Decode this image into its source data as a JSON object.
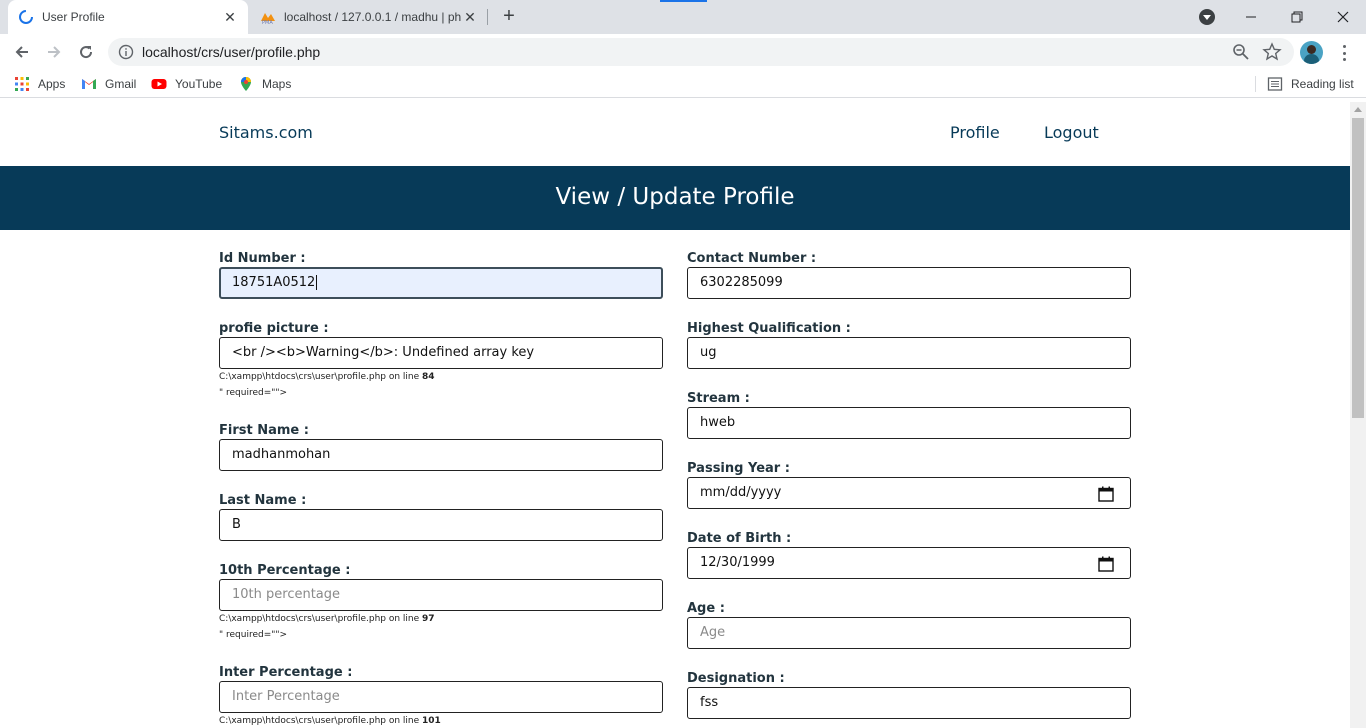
{
  "browser": {
    "tabs": [
      {
        "title": "User Profile"
      },
      {
        "title": "localhost / 127.0.0.1 / madhu | ph"
      }
    ],
    "url": "localhost/crs/user/profile.php",
    "bookmarks": [
      {
        "label": "Apps",
        "icon": "apps-grid-icon"
      },
      {
        "label": "Gmail",
        "icon": "gmail-icon"
      },
      {
        "label": "YouTube",
        "icon": "youtube-icon"
      },
      {
        "label": "Maps",
        "icon": "maps-icon"
      }
    ],
    "reading_list": "Reading list"
  },
  "site": {
    "brand": "Sitams.com",
    "nav": [
      "Profile",
      "Logout"
    ],
    "banner": "View / Update Profile"
  },
  "form": {
    "id_number": {
      "label": "Id Number :",
      "value": "18751A0512"
    },
    "profile_picture": {
      "label": "profie picture :",
      "value": "<br /><b>Warning</b>:  Undefined array key",
      "warning_path": "C:\\xampp\\htdocs\\crs\\user\\profile.php on line ",
      "warning_line": "84",
      "warning_tail": "\" required=\"\">"
    },
    "first_name": {
      "label": "First Name :",
      "value": "madhanmohan"
    },
    "last_name": {
      "label": "Last Name :",
      "value": "B"
    },
    "tenth": {
      "label": "10th Percentage :",
      "placeholder": "10th percentage",
      "warning_path": "C:\\xampp\\htdocs\\crs\\user\\profile.php on line ",
      "warning_line": "97",
      "warning_tail": "\" required=\"\">"
    },
    "inter": {
      "label": "Inter Percentage :",
      "placeholder": "Inter Percentage",
      "warning_path": "C:\\xampp\\htdocs\\crs\\user\\profile.php on line ",
      "warning_line": "101"
    },
    "contact": {
      "label": "Contact Number :",
      "value": "6302285099"
    },
    "qualification": {
      "label": "Highest Qualification :",
      "value": "ug"
    },
    "stream": {
      "label": "Stream :",
      "value": "hweb"
    },
    "passing_year": {
      "label": "Passing Year :",
      "value": "mm/dd/yyyy"
    },
    "dob": {
      "label": "Date of Birth :",
      "value": "12/30/1999"
    },
    "age": {
      "label": "Age :",
      "placeholder": "Age"
    },
    "designation": {
      "label": "Designation :",
      "value": "fss"
    }
  },
  "colors": {
    "brand": "#073a58",
    "input_focus_bg": "#e8f0fe"
  }
}
